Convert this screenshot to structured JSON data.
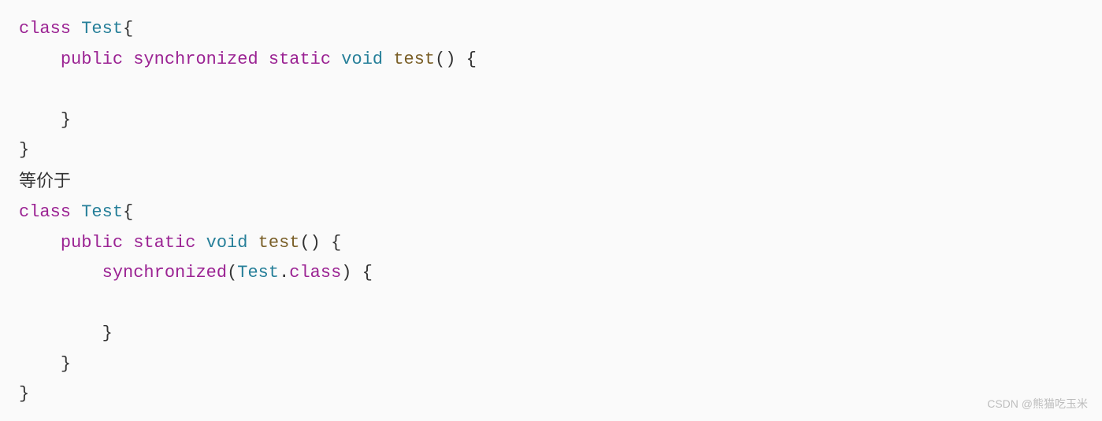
{
  "code": {
    "block1": {
      "l1": {
        "kwClass": "class",
        "typeName": "Test",
        "brace": "{"
      },
      "l2": {
        "kwPublic": "public",
        "kwSync": "synchronized",
        "kwStatic": "static",
        "kwVoid": "void",
        "methodName": "test",
        "parens": "()",
        "brace": "{"
      },
      "l3": "",
      "l4": {
        "brace": "}"
      },
      "l5": {
        "brace": "}"
      }
    },
    "separator": "等价于",
    "block2": {
      "l1": {
        "kwClass": "class",
        "typeName": "Test",
        "brace": "{"
      },
      "l2": {
        "kwPublic": "public",
        "kwStatic": "static",
        "kwVoid": "void",
        "methodName": "test",
        "parens": "()",
        "brace": "{"
      },
      "l3": {
        "kwSync": "synchronized",
        "openParen": "(",
        "typeName": "Test",
        "dot": ".",
        "kwClassref": "class",
        "closeParen": ")",
        "brace": "{"
      },
      "l4": "",
      "l5": {
        "brace": "}"
      },
      "l6": {
        "brace": "}"
      },
      "l7": {
        "brace": "}"
      }
    }
  },
  "watermark": "CSDN @熊猫吃玉米"
}
